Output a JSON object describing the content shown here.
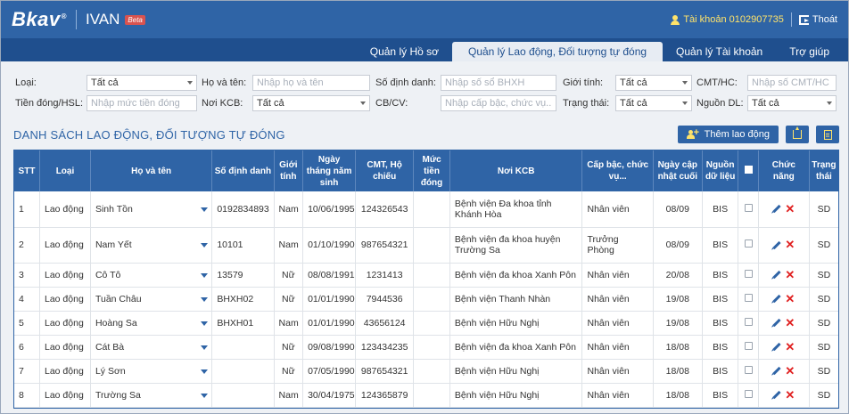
{
  "header": {
    "logo": "Bkav",
    "app_name": "IVAN",
    "beta": "Beta",
    "account_label": "Tài khoản 0102907735",
    "logout_label": "Thoát"
  },
  "nav": {
    "tabs": [
      {
        "label": "Quản lý Hồ sơ"
      },
      {
        "label": "Quản lý Lao động, Đối tượng tự đóng"
      },
      {
        "label": "Quản lý Tài khoản"
      },
      {
        "label": "Trợ giúp"
      }
    ],
    "active_tab": "Quản lý Lao động, Đối tượng tự đóng"
  },
  "filters": {
    "loai": {
      "label": "Loại:",
      "value": "Tất cả"
    },
    "ho_ten": {
      "label": "Họ và tên:",
      "placeholder": "Nhập họ và tên"
    },
    "so_dinh_danh": {
      "label": "Số định danh:",
      "placeholder": "Nhập số sổ BHXH"
    },
    "gioi_tinh": {
      "label": "Giới tính:",
      "value": "Tất cả"
    },
    "cmt": {
      "label": "CMT/HC:",
      "placeholder": "Nhập số CMT/HC"
    },
    "tien_dong": {
      "label": "Tiền đóng/HSL:",
      "placeholder": "Nhập mức tiền đóng"
    },
    "noi_kcb": {
      "label": "Nơi KCB:",
      "value": "Tất cả"
    },
    "cb_cv": {
      "label": "CB/CV:",
      "placeholder": "Nhập cấp bậc, chức vụ..."
    },
    "trang_thai": {
      "label": "Trạng thái:",
      "value": "Tất cả"
    },
    "nguon_dl": {
      "label": "Nguồn DL:",
      "value": "Tất cả"
    }
  },
  "list": {
    "title": "DANH SÁCH LAO ĐỘNG, ĐỐI TƯỢNG TỰ ĐÓNG",
    "add_button": "Thêm lao động",
    "export_icon": "export-icon",
    "import_icon": "document-icon"
  },
  "table": {
    "headers": {
      "stt": "STT",
      "loai": "Loại",
      "ho_ten": "Họ và tên",
      "so_dinh_danh": "Số định danh",
      "gioi_tinh": "Giới tính",
      "ngay_sinh": "Ngày tháng năm sinh",
      "cmt": "CMT, Hộ chiếu",
      "muc_tien": "Mức tiền đóng",
      "noi_kcb": "Nơi KCB",
      "cap_bac": "Cấp bậc, chức vụ...",
      "ngay_cap_nhat": "Ngày cập nhật cuối",
      "nguon": "Nguồn dữ liệu",
      "chuc_nang": "Chức năng",
      "trang_thai": "Trạng thái"
    },
    "rows": [
      {
        "stt": "1",
        "loai": "Lao động",
        "ho_ten": "Sinh Tồn",
        "so_dinh_danh": "0192834893",
        "gioi_tinh": "Nam",
        "ngay_sinh": "10/06/1995",
        "cmt": "124326543",
        "muc_tien": "",
        "noi_kcb": "Bệnh viện Đa khoa tỉnh Khánh Hòa",
        "cap_bac": "Nhân viên",
        "ngay_cap_nhat": "08/09",
        "nguon": "BIS",
        "trang_thai": "SD"
      },
      {
        "stt": "2",
        "loai": "Lao động",
        "ho_ten": "Nam Yết",
        "so_dinh_danh": "10101",
        "gioi_tinh": "Nam",
        "ngay_sinh": "01/10/1990",
        "cmt": "987654321",
        "muc_tien": "",
        "noi_kcb": "Bệnh viện đa khoa huyện Trường Sa",
        "cap_bac": "Trưởng Phòng",
        "ngay_cap_nhat": "08/09",
        "nguon": "BIS",
        "trang_thai": "SD"
      },
      {
        "stt": "3",
        "loai": "Lao động",
        "ho_ten": "Cô Tô",
        "so_dinh_danh": "13579",
        "gioi_tinh": "Nữ",
        "ngay_sinh": "08/08/1991",
        "cmt": "1231413",
        "muc_tien": "",
        "noi_kcb": "Bệnh viện đa khoa Xanh Pôn",
        "cap_bac": "Nhân viên",
        "ngay_cap_nhat": "20/08",
        "nguon": "BIS",
        "trang_thai": "SD"
      },
      {
        "stt": "4",
        "loai": "Lao động",
        "ho_ten": "Tuần Châu",
        "so_dinh_danh": "BHXH02",
        "gioi_tinh": "Nữ",
        "ngay_sinh": "01/01/1990",
        "cmt": "7944536",
        "muc_tien": "",
        "noi_kcb": "Bệnh viện Thanh Nhàn",
        "cap_bac": "Nhân viên",
        "ngay_cap_nhat": "19/08",
        "nguon": "BIS",
        "trang_thai": "SD"
      },
      {
        "stt": "5",
        "loai": "Lao động",
        "ho_ten": "Hoàng Sa",
        "so_dinh_danh": "BHXH01",
        "gioi_tinh": "Nam",
        "ngay_sinh": "01/01/1990",
        "cmt": "43656124",
        "muc_tien": "",
        "noi_kcb": "Bệnh viện Hữu Nghị",
        "cap_bac": "Nhân viên",
        "ngay_cap_nhat": "19/08",
        "nguon": "BIS",
        "trang_thai": "SD"
      },
      {
        "stt": "6",
        "loai": "Lao động",
        "ho_ten": "Cát Bà",
        "so_dinh_danh": "",
        "gioi_tinh": "Nữ",
        "ngay_sinh": "09/08/1990",
        "cmt": "123434235",
        "muc_tien": "",
        "noi_kcb": "Bệnh viện đa khoa Xanh Pôn",
        "cap_bac": "Nhân viên",
        "ngay_cap_nhat": "18/08",
        "nguon": "BIS",
        "trang_thai": "SD"
      },
      {
        "stt": "7",
        "loai": "Lao động",
        "ho_ten": "Lý Sơn",
        "so_dinh_danh": "",
        "gioi_tinh": "Nữ",
        "ngay_sinh": "07/05/1990",
        "cmt": "987654321",
        "muc_tien": "",
        "noi_kcb": "Bệnh viện Hữu Nghị",
        "cap_bac": "Nhân viên",
        "ngay_cap_nhat": "18/08",
        "nguon": "BIS",
        "trang_thai": "SD"
      },
      {
        "stt": "8",
        "loai": "Lao động",
        "ho_ten": "Trường Sa",
        "so_dinh_danh": "",
        "gioi_tinh": "Nam",
        "ngay_sinh": "30/04/1975",
        "cmt": "124365879",
        "muc_tien": "",
        "noi_kcb": "Bệnh viện Hữu Nghị",
        "cap_bac": "Nhân viên",
        "ngay_cap_nhat": "18/08",
        "nguon": "BIS",
        "trang_thai": "SD"
      }
    ]
  }
}
